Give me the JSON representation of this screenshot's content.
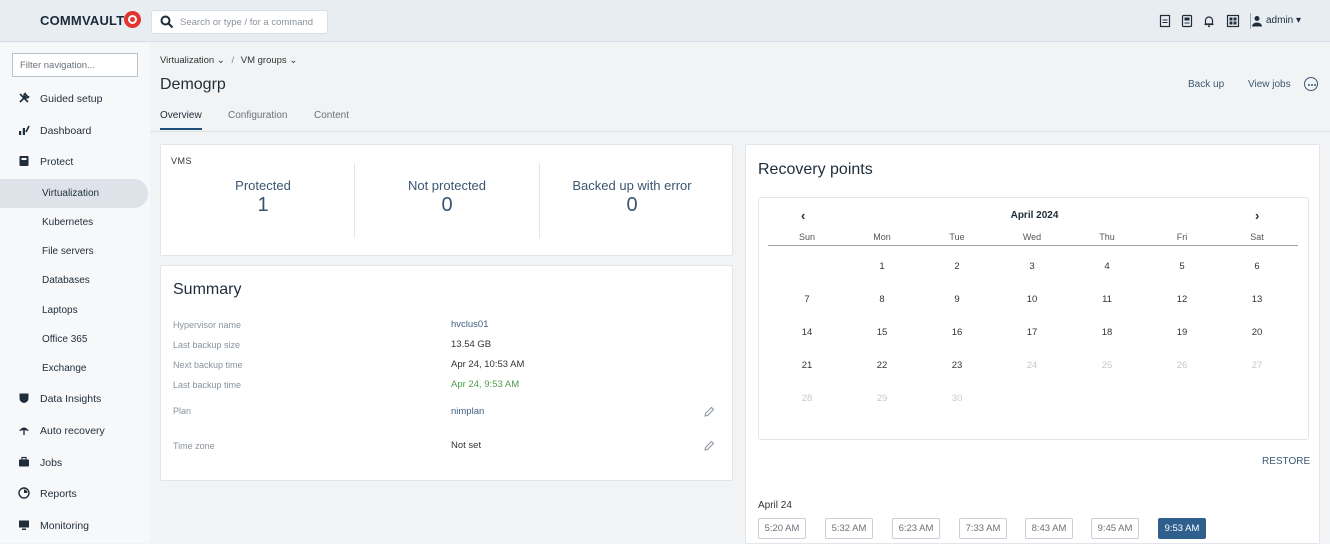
{
  "header": {
    "logo": "COMMVAULT",
    "search_placeholder": "Search or type / for a command",
    "user": "admin ▾"
  },
  "sidebar": {
    "filter_placeholder": "Filter navigation...",
    "items": [
      {
        "label": "Guided setup",
        "icon": "tools-icon"
      },
      {
        "label": "Dashboard",
        "icon": "dashboard-icon"
      },
      {
        "label": "Protect",
        "icon": "shield-icon"
      },
      {
        "label": "Virtualization",
        "sub": true,
        "active": true
      },
      {
        "label": "Kubernetes",
        "sub": true
      },
      {
        "label": "File servers",
        "sub": true
      },
      {
        "label": "Databases",
        "sub": true
      },
      {
        "label": "Laptops",
        "sub": true
      },
      {
        "label": "Office 365",
        "sub": true
      },
      {
        "label": "Exchange",
        "sub": true
      },
      {
        "label": "Data Insights",
        "icon": "insights-icon"
      },
      {
        "label": "Auto recovery",
        "icon": "recovery-icon"
      },
      {
        "label": "Jobs",
        "icon": "briefcase-icon"
      },
      {
        "label": "Reports",
        "icon": "reports-icon"
      },
      {
        "label": "Monitoring",
        "icon": "monitor-icon"
      }
    ]
  },
  "breadcrumb": {
    "first": "Virtualization ⌄",
    "sep": "/",
    "second": "VM groups ⌄"
  },
  "page": {
    "title": "Demogrp",
    "back_up": "Back up",
    "view_jobs": "View jobs"
  },
  "tabs": [
    "Overview",
    "Configuration",
    "Content"
  ],
  "vms": {
    "label": "VMS",
    "stats": [
      {
        "label": "Protected",
        "value": "1"
      },
      {
        "label": "Not protected",
        "value": "0"
      },
      {
        "label": "Backed up with error",
        "value": "0"
      }
    ]
  },
  "summary": {
    "title": "Summary",
    "rows": [
      {
        "label": "Hypervisor name",
        "value": "hvclus01"
      },
      {
        "label": "Last backup size",
        "value": "13.54 GB"
      },
      {
        "label": "Next backup time",
        "value": "Apr 24, 10:53 AM"
      },
      {
        "label": "Last backup time",
        "value": "Apr 24, 9:53 AM"
      },
      {
        "label": "Plan",
        "value": "nimplan"
      },
      {
        "label": "Time zone",
        "value": "Not set"
      }
    ]
  },
  "recovery": {
    "title": "Recovery points",
    "month": "April 2024",
    "prev": "‹",
    "next": "›",
    "days_of_week": [
      "Sun",
      "Mon",
      "Tue",
      "Wed",
      "Thu",
      "Fri",
      "Sat"
    ],
    "weeks": [
      [
        "",
        "1",
        "2",
        "3",
        "4",
        "5",
        "6"
      ],
      [
        "7",
        "8",
        "9",
        "10",
        "11",
        "12",
        "13"
      ],
      [
        "14",
        "15",
        "16",
        "17",
        "18",
        "19",
        "20"
      ],
      [
        "21",
        "22",
        "23",
        "24",
        "25",
        "26",
        "27"
      ],
      [
        "28",
        "29",
        "30",
        "",
        "",
        "",
        ""
      ]
    ],
    "dim_from": 24,
    "restore": "RESTORE",
    "selected_date": "April 24",
    "times": [
      "5:20 AM",
      "5:32 AM",
      "6:23 AM",
      "7:33 AM",
      "8:43 AM",
      "9:45 AM",
      "9:53 AM"
    ],
    "selected_time": "9:53 AM"
  }
}
